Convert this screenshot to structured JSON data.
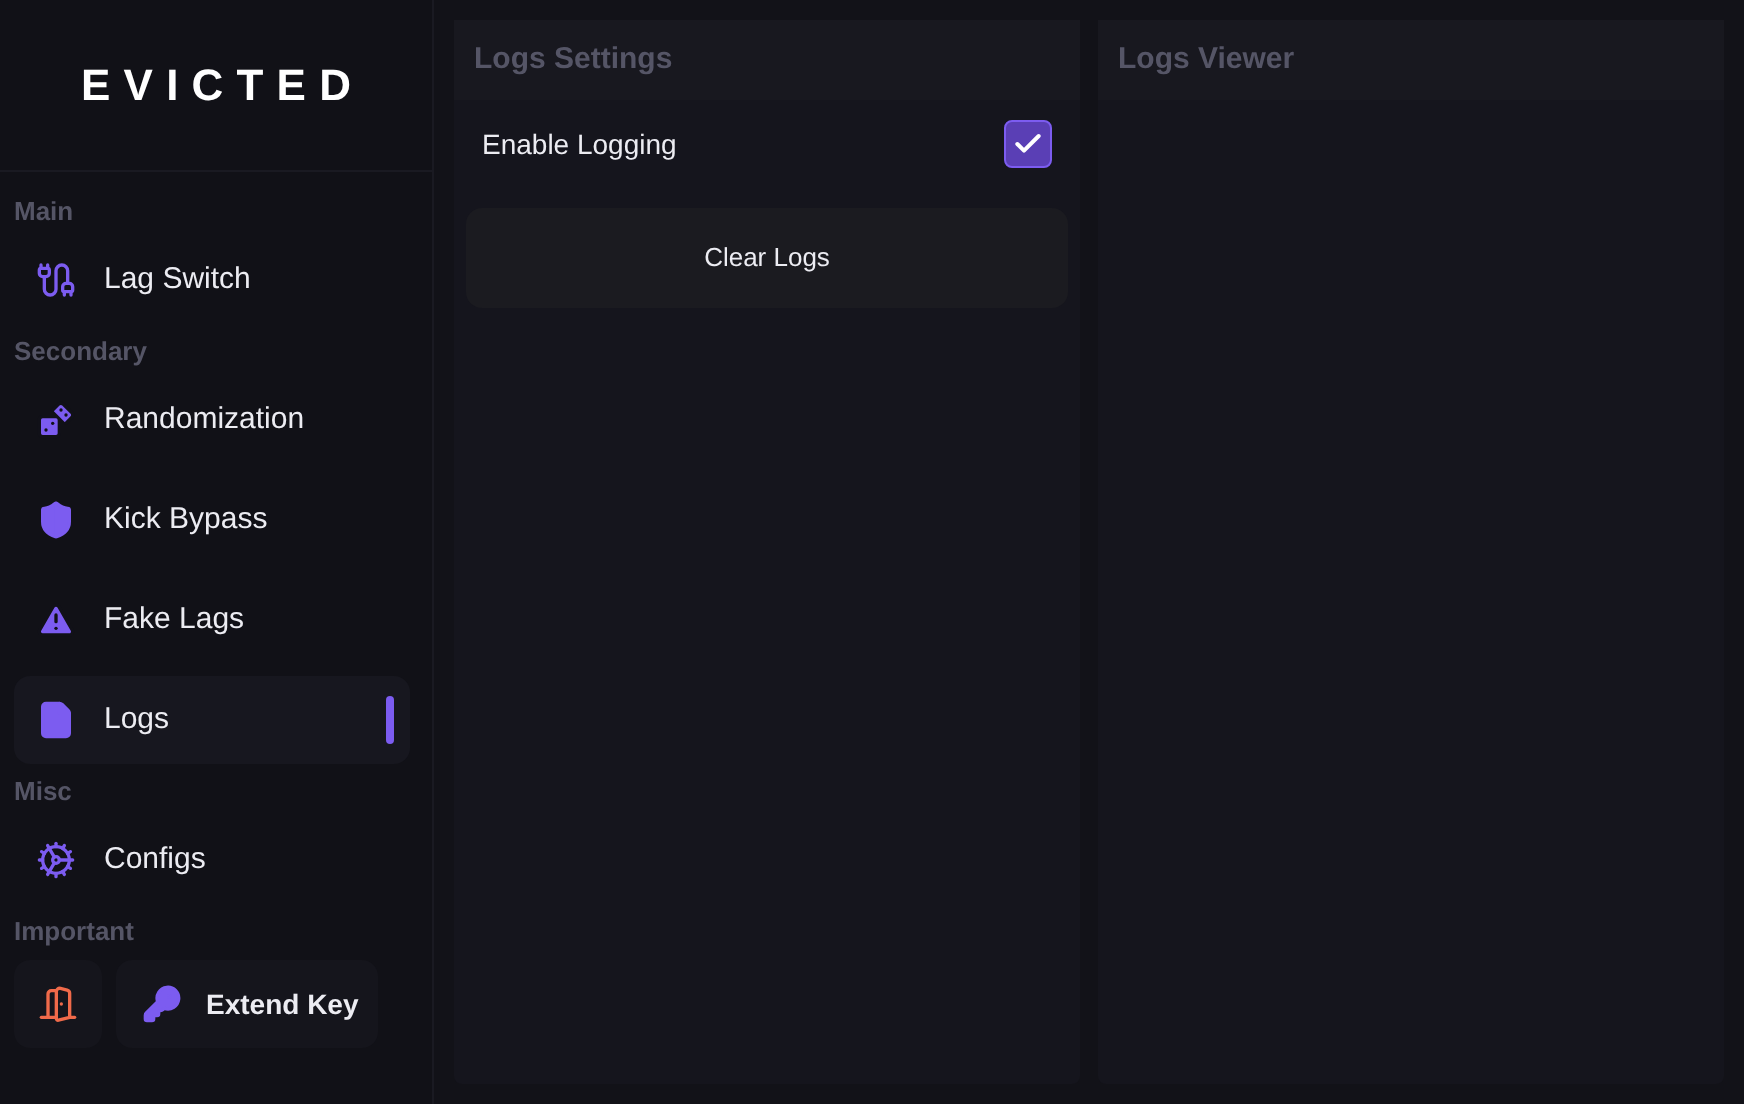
{
  "logo": "EVICTED",
  "sidebar": {
    "sections": [
      {
        "label": "Main",
        "items": [
          {
            "label": "Lag Switch",
            "selected": false
          }
        ]
      },
      {
        "label": "Secondary",
        "items": [
          {
            "label": "Randomization",
            "selected": false
          },
          {
            "label": "Kick Bypass",
            "selected": false
          },
          {
            "label": "Fake Lags",
            "selected": false
          },
          {
            "label": "Logs",
            "selected": true
          }
        ]
      },
      {
        "label": "Misc",
        "items": [
          {
            "label": "Configs",
            "selected": false
          }
        ]
      }
    ],
    "important": {
      "label": "Important",
      "extend_key": "Extend Key"
    }
  },
  "panels": [
    {
      "title": "Logs Settings",
      "rows": [
        {
          "kind": "checkbox",
          "label": "Enable Logging",
          "checked": true
        },
        {
          "kind": "button",
          "label": "Clear Logs"
        }
      ]
    },
    {
      "title": "Logs Viewer"
    }
  ]
}
